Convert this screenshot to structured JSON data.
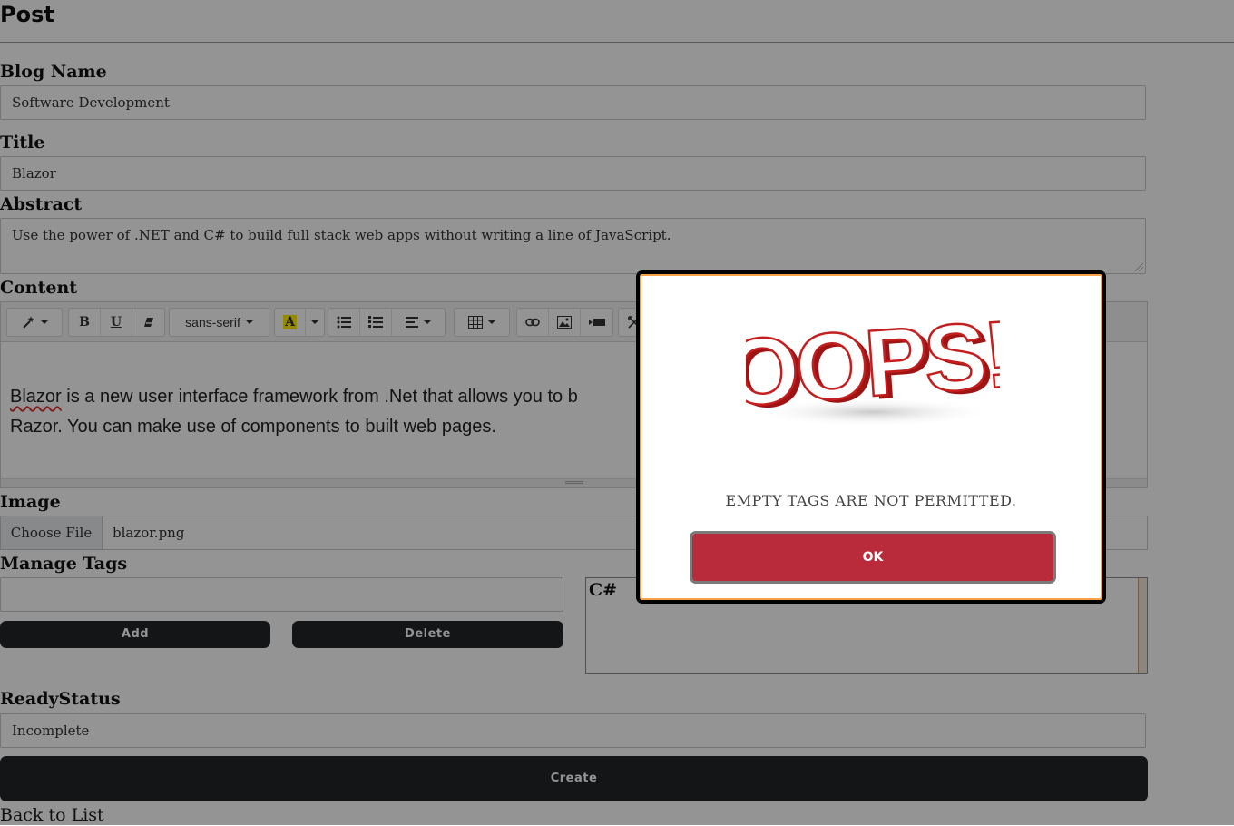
{
  "page": {
    "heading": "Post",
    "blog_name": {
      "label": "Blog Name",
      "value": "Software Development"
    },
    "title": {
      "label": "Title",
      "value": "Blazor"
    },
    "abstract": {
      "label": "Abstract",
      "value": "Use the power of .NET and C# to build full stack web apps without writing a line of JavaScript."
    },
    "content": {
      "label": "Content",
      "toolbar": {
        "font_name": "sans-serif",
        "bold": "B",
        "underline": "U",
        "highlight": "A"
      },
      "body_misspelled": "Blazor",
      "body_line1_rest": " is a new user interface framework from .Net that allows you to b",
      "body_line2": "Razor. You can make use of components to built web pages."
    },
    "image": {
      "label": "Image",
      "button": "Choose File",
      "file_name": "blazor.png"
    },
    "tags": {
      "label": "Manage Tags",
      "input_value": "",
      "add_button": "Add",
      "delete_button": "Delete",
      "items": [
        "C#"
      ]
    },
    "ready_status": {
      "label": "ReadyStatus",
      "value": "Incomplete"
    },
    "create_button": "Create",
    "back_link": "Back to List"
  },
  "modal": {
    "image_text": "OOPS!",
    "message": "EMPTY TAGS ARE NOT PERMITTED.",
    "ok_button": "OK"
  },
  "colors": {
    "ok_button": "#b92a3b",
    "modal_accent_border": "#f5a346",
    "dark_button": "#212529"
  },
  "icons": {
    "magic": "magic-wand-icon",
    "eraser": "eraser-icon",
    "ul": "unordered-list-icon",
    "ol": "ordered-list-icon",
    "align": "align-icon",
    "table": "table-icon",
    "link": "link-icon",
    "picture": "picture-icon",
    "video": "video-icon",
    "fullscreen": "fullscreen-icon"
  }
}
